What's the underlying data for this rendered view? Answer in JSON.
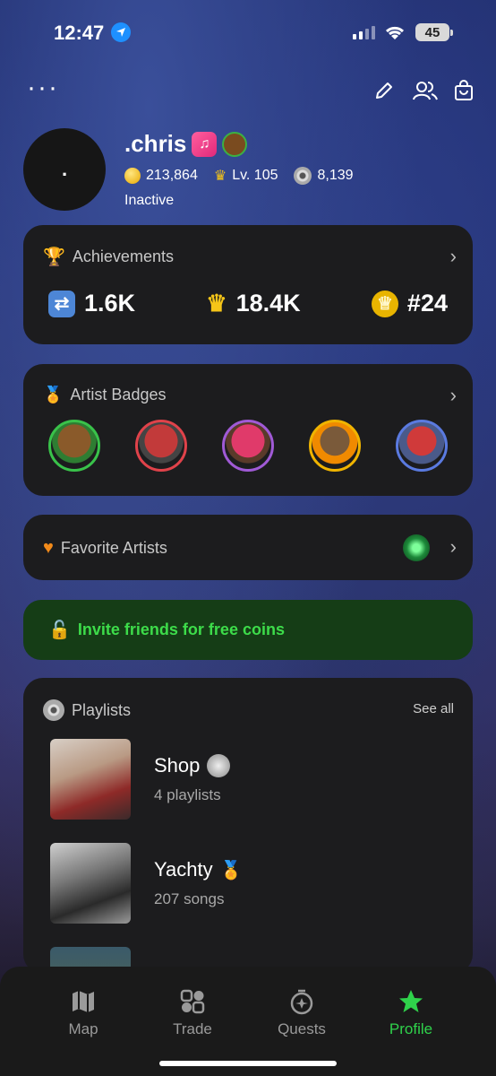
{
  "status_bar": {
    "time": "12:47",
    "battery": "45"
  },
  "profile": {
    "avatar_text": ".",
    "username": ".chris",
    "coins": "213,864",
    "level": "Lv. 105",
    "discs": "8,139",
    "status": "Inactive"
  },
  "achievements": {
    "title": "Achievements",
    "items": [
      {
        "icon": "repeat-icon",
        "value": "1.6K"
      },
      {
        "icon": "crown-icon",
        "value": "18.4K"
      },
      {
        "icon": "rank-medal-icon",
        "value": "#24"
      }
    ]
  },
  "artist_badges": {
    "title": "Artist Badges"
  },
  "favorite_artists": {
    "title": "Favorite Artists"
  },
  "invite": {
    "label": "Invite friends for free coins"
  },
  "playlists": {
    "title": "Playlists",
    "see_all": "See all",
    "items": [
      {
        "name": "Shop",
        "sub": "4 playlists"
      },
      {
        "name": "Yachty",
        "sub": "207 songs"
      }
    ]
  },
  "tabs": [
    {
      "label": "Map",
      "icon": "map-icon"
    },
    {
      "label": "Trade",
      "icon": "trade-icon"
    },
    {
      "label": "Quests",
      "icon": "quests-icon"
    },
    {
      "label": "Profile",
      "icon": "star-icon"
    }
  ],
  "colors": {
    "accent_green": "#2fd24b",
    "card_bg": "#1c1c1e",
    "invite_bg": "#153d16"
  }
}
